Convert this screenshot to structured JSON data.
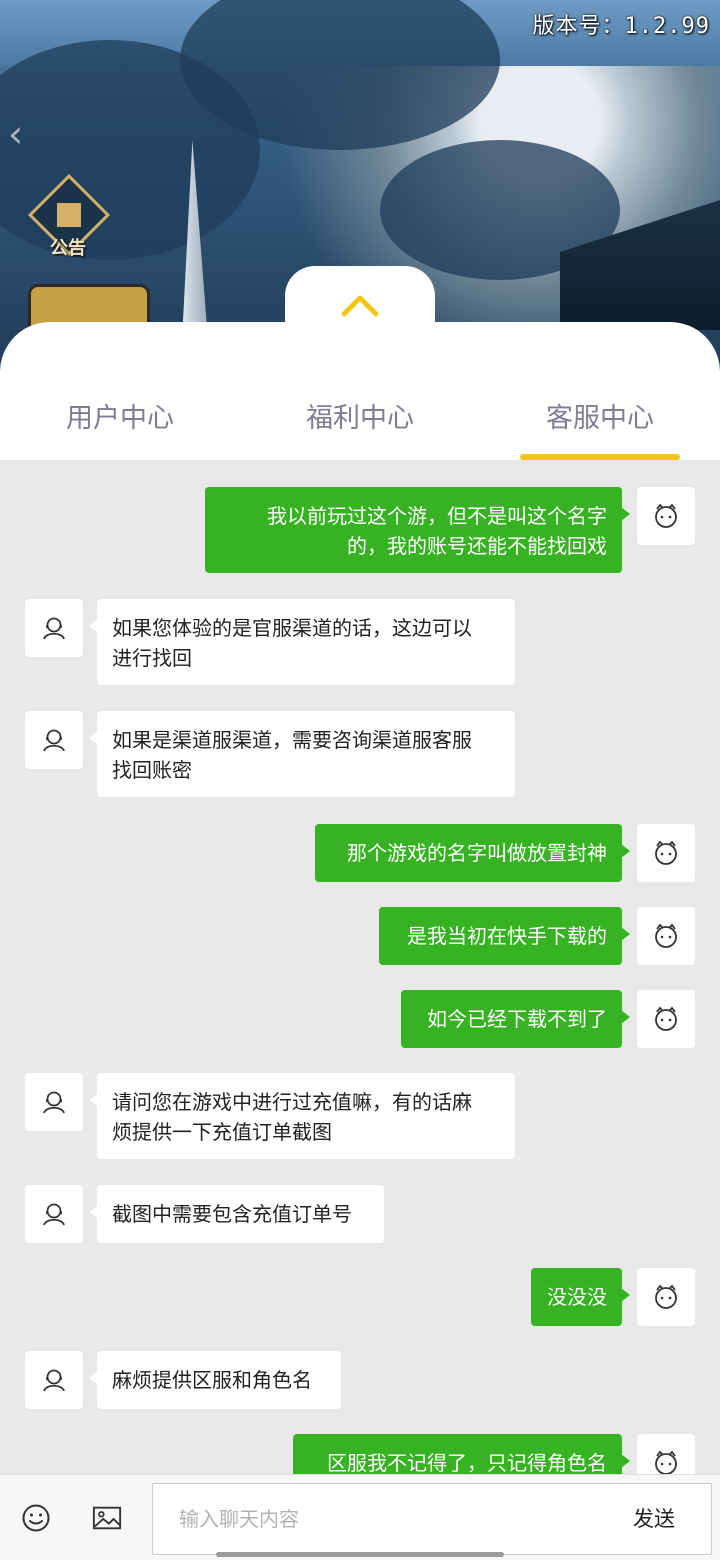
{
  "header": {
    "version_text": "版本号：1.2.99"
  },
  "game_overlay": {
    "notice_label": "公告"
  },
  "tabs": [
    {
      "label": "用户中心",
      "active": false
    },
    {
      "label": "福利中心",
      "active": false
    },
    {
      "label": "客服中心",
      "active": true
    }
  ],
  "accent_color": "#f5c518",
  "bubble_colors": {
    "me": "#37b222",
    "cs": "#ffffff"
  },
  "messages": [
    {
      "from": "me",
      "lines": [
        "我以前玩过这个游，但不是叫这个名字",
        "的，我的账号还能不能找回戏"
      ]
    },
    {
      "from": "cs",
      "lines": [
        "如果您体验的是官服渠道的话，这边可以",
        "进行找回"
      ]
    },
    {
      "from": "cs",
      "lines": [
        "如果是渠道服渠道，需要咨询渠道服客服",
        "找回账密"
      ]
    },
    {
      "from": "me",
      "lines": [
        "那个游戏的名字叫做放置封神"
      ]
    },
    {
      "from": "me",
      "lines": [
        "是我当初在快手下载的"
      ]
    },
    {
      "from": "me",
      "lines": [
        "如今已经下载不到了"
      ]
    },
    {
      "from": "cs",
      "lines": [
        "请问您在游戏中进行过充值嘛，有的话麻",
        "烦提供一下充值订单截图"
      ]
    },
    {
      "from": "cs",
      "lines": [
        "截图中需要包含充值订单号"
      ]
    },
    {
      "from": "me",
      "lines": [
        "没没没"
      ]
    },
    {
      "from": "cs",
      "lines": [
        "麻烦提供区服和角色名"
      ]
    },
    {
      "from": "me",
      "lines": [
        "区服我不记得了，只记得角色名"
      ]
    }
  ],
  "input": {
    "placeholder": "输入聊天内容",
    "value": "",
    "send_label": "发送"
  }
}
